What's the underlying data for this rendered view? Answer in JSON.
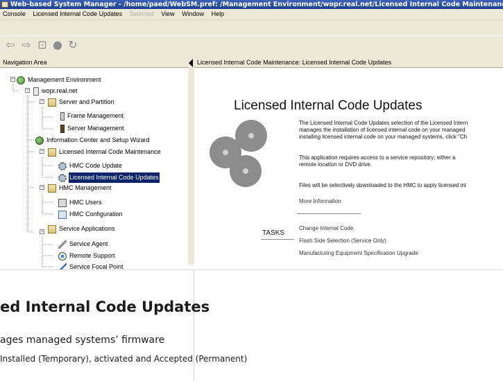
{
  "window": {
    "title": "Web-based System Manager - /home/paed/WebSM.pref: /Management Environment/wopr.real.net/Licensed Internal Code Maintenance"
  },
  "menubar": {
    "items": [
      "Console",
      "Licensed Internal Code Updates",
      "Selected",
      "View",
      "Window",
      "Help"
    ],
    "disabled_item": "Selected"
  },
  "toolbar": {
    "icons": [
      "back-arrow-icon",
      "forward-arrow-icon",
      "up-folder-icon",
      "stop-icon",
      "refresh-icon"
    ],
    "glyphs": [
      "⇦",
      "⇨",
      "⊡",
      "●",
      "↻"
    ]
  },
  "nav": {
    "header": "Navigation Area",
    "items": [
      {
        "label": "Management Environment",
        "icon": "management-environment-icon"
      },
      {
        "label": "wopr.real.net",
        "icon": "system-icon"
      },
      {
        "label": "Server and Partition",
        "icon": "folder-icon"
      },
      {
        "label": "Frame Management",
        "icon": "frame-icon"
      },
      {
        "label": "Server Management",
        "icon": "server-icon"
      },
      {
        "label": "Information Center and Setup Wizard",
        "icon": "globe-icon"
      },
      {
        "label": "Licensed Internal Code Maintenance",
        "icon": "folder-icon"
      },
      {
        "label": "HMC Code Update",
        "icon": "gear-icon"
      },
      {
        "label": "Licensed Internal Code Updates",
        "icon": "gear-icon"
      },
      {
        "label": "HMC Management",
        "icon": "folder-icon"
      },
      {
        "label": "HMC Users",
        "icon": "users-icon"
      },
      {
        "label": "HMC Configuration",
        "icon": "config-icon"
      },
      {
        "label": "Service Applications",
        "icon": "folder-icon"
      },
      {
        "label": "Service Agent",
        "icon": "wrench-icon"
      },
      {
        "label": "Remote Support",
        "icon": "network-icon"
      },
      {
        "label": "Service Focal Point",
        "icon": "focal-icon"
      }
    ],
    "selected": "Licensed Internal Code Updates"
  },
  "content": {
    "header": "Licensed Internal Code Maintenance: Licensed Internal Code Updates",
    "title": "Licensed Internal Code Updates",
    "para1": [
      "The Licensed Internal Code Updates selection of the Licensed Intern",
      "manages the installation of licensed internal code on your managed",
      "installing licensed internal code on your managed systems, click \"Ch"
    ],
    "para2": [
      "This application requires access to a service repository; either a",
      "remote location or DVD drive."
    ],
    "para3": "Files will be selectively downloaded to the HMC to apply licensed int",
    "more_info": "More Information",
    "tasks_label": "TASKS",
    "tasks": [
      "Change Internal Code",
      "Flash Side Selection (Service Only)",
      "Manufacturing Equipment Specification Upgrade"
    ]
  },
  "caption": {
    "title": "ed Internal Code Updates",
    "line1": "ages managed systems’ firmware",
    "line2": "Installed (Temporary), activated and Accepted (Permanent)"
  }
}
